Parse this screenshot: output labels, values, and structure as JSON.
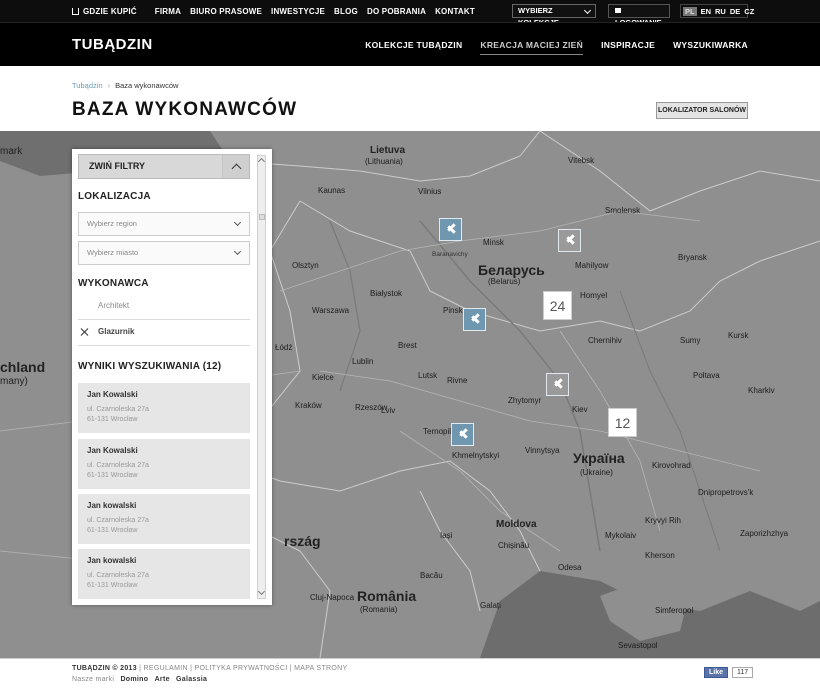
{
  "topbar": {
    "links": [
      "GDZIE KUPIĆ",
      "FIRMA",
      "BIURO PRASOWE",
      "INWESTYCJE",
      "BLOG",
      "DO POBRANIA",
      "KONTAKT"
    ],
    "collections_select": "WYBIERZ KOLEKCJĘ",
    "login": "LOGOWANIE",
    "languages": [
      "PL",
      "EN",
      "RU",
      "DE",
      "CZ"
    ],
    "active_language": "PL"
  },
  "nav": {
    "logo": "TUBĄDZIN",
    "items": [
      "KOLEKCJE TUBĄDZIN",
      "KREACJA MACIEJ ZIEŃ",
      "INSPIRACJE",
      "WYSZUKIWARKA"
    ],
    "active": "KREACJA MACIEJ ZIEŃ"
  },
  "breadcrumb": {
    "home": "Tubądzin",
    "separator": "›",
    "current": "Baza wykonawców"
  },
  "page_title": "BAZA WYKONAWCÓW",
  "locator_button": "LOKALIZATOR SALONÓW",
  "filters": {
    "toggle_label": "ZWIŃ FILTRY",
    "location_heading": "LOKALIZACJA",
    "region_placeholder": "Wybierz region",
    "city_placeholder": "Wybierz miasto",
    "contractor_heading": "WYKONAWCA",
    "options": [
      {
        "label": "Architekt",
        "checked": false
      },
      {
        "label": "Glazurnik",
        "checked": true
      }
    ],
    "results_heading": "WYNIKI WYSZUKIWANIA (12)",
    "results": [
      {
        "name": "Jan Kowalski",
        "street": "ul. Czarnoleska 27a",
        "city": "61-131 Wrocław"
      },
      {
        "name": "Jan Kowalski",
        "street": "ul. Czarnoleska 27a",
        "city": "61-131 Wrocław"
      },
      {
        "name": "Jan kowalski",
        "street": "ul. Czarnoleska 27a",
        "city": "61-131 Wrocław"
      },
      {
        "name": "Jan kowalski",
        "street": "ul. Czarnoleska 27a",
        "city": "61-131 Wrocław"
      }
    ]
  },
  "map": {
    "clusters": [
      "24",
      "12"
    ],
    "labels": {
      "lietuva": "Lietuva",
      "lithuania": "(Lithuania)",
      "belarus": "Беларусь",
      "belarus_en": "(Belarus)",
      "ukraina": "Україна",
      "ukraine_en": "(Ukraine)",
      "romania": "România",
      "romania_en": "(Romania)",
      "moldova": "Moldova",
      "chland": "chland",
      "many": "many)",
      "mark": "mark",
      "rsag": "rszág",
      "vilnius": "Vilnius",
      "minsk": "Minsk",
      "vitebsk": "Vitebsk",
      "smolensk": "Smolensk",
      "homyel": "Homyel",
      "bryansk": "Bryansk",
      "warszawa": "Warszawa",
      "lodz": "Łódź",
      "lublin": "Lublin",
      "kiev": "Kiev",
      "zhytomyr": "Zhytomyr",
      "chernihiv": "Chernihiv",
      "kharkiv": "Kharkiv",
      "poltava": "Poltava",
      "dnipro": "Dnipropetrovs'k",
      "zaporizhzhya": "Zaporizhzhya",
      "odesa": "Odesa",
      "mykolaiv": "Mykolaiv",
      "kherson": "Kherson",
      "chisinau": "Chișinău",
      "lviv": "Lviv",
      "rivne": "Rivne",
      "ternopil": "Ternopil",
      "khmelnytskyi": "Khmelnytskyi",
      "vinnytsya": "Vinnytsya",
      "kirovohrad": "Kirovohrad",
      "kryvyi": "Kryvyi Rih",
      "sumy": "Sumy",
      "kursk": "Kursk",
      "bialystok": "Białystok",
      "kaunas": "Kaunas",
      "olsztyn": "Olsztyn",
      "kielce": "Kielce",
      "krakow": "Kraków",
      "rzeszow": "Rzeszów",
      "iasi": "Iași",
      "bacau": "Bacău",
      "galati": "Galați",
      "cluj": "Cluj-Napoca",
      "sevastopol": "Sevastopol",
      "simferopol": "Simferopol",
      "mogilev": "Mahilyow",
      "baranovichi": "Baranavichy",
      "pinsk": "Pinsk",
      "brest": "Brest",
      "lutsk": "Lutsk"
    }
  },
  "footer": {
    "copyright": "TUBĄDZIN © 2013",
    "links": [
      "REGULAMIN",
      "POLITYKA PRYWATNOŚCI",
      "MAPA STRONY"
    ],
    "brands_label": "Nasze marki",
    "brands": [
      "Domino",
      "Arte",
      "Galassia"
    ],
    "fb_like": "Like",
    "fb_count": "117"
  }
}
